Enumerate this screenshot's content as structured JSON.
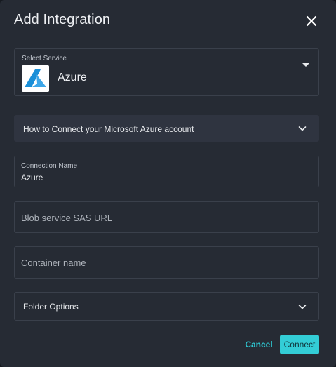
{
  "dialog": {
    "title": "Add Integration",
    "close_icon": "close-icon"
  },
  "service": {
    "label": "Select Service",
    "value": "Azure",
    "logo_icon": "azure-logo-icon",
    "caret_icon": "caret-down-icon"
  },
  "how_to": {
    "label": "How to Connect your Microsoft Azure account",
    "icon": "chevron-down-icon"
  },
  "connection_name": {
    "label": "Connection Name",
    "value": "Azure"
  },
  "blob_sas_url": {
    "placeholder": "Blob service SAS URL"
  },
  "container_name": {
    "placeholder": "Container name"
  },
  "folder_options": {
    "label": "Folder Options",
    "icon": "chevron-down-icon"
  },
  "actions": {
    "cancel_label": "Cancel",
    "connect_label": "Connect"
  },
  "colors": {
    "background": "#262b34",
    "accent": "#33cdd6",
    "border": "#3a404b",
    "accordion": "#2f3440"
  }
}
